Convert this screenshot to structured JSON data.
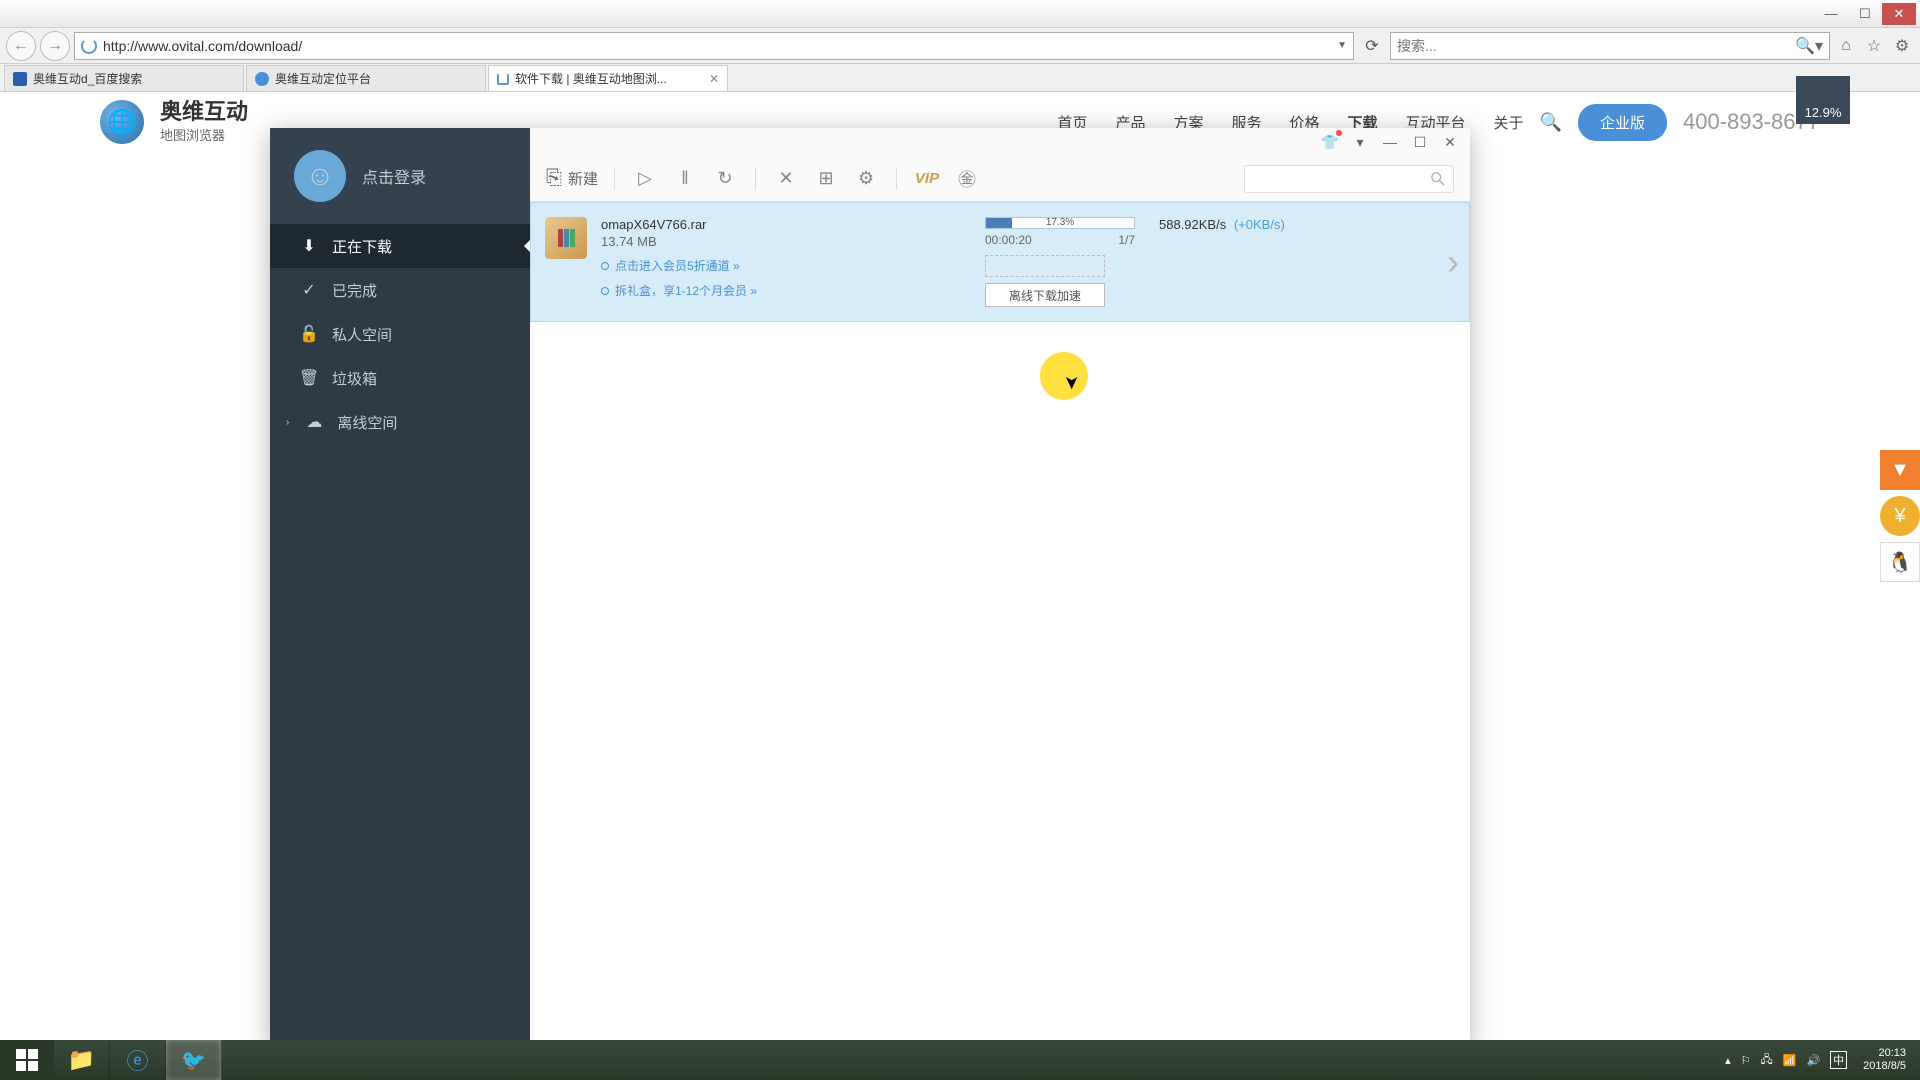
{
  "browser": {
    "url": "http://www.ovital.com/download/",
    "search_placeholder": "搜索...",
    "tabs": [
      {
        "label": "奥维互动d_百度搜索"
      },
      {
        "label": "奥维互动定位平台"
      },
      {
        "label": "软件下载 | 奥维互动地图浏..."
      }
    ]
  },
  "site": {
    "title": "奥维互动",
    "subtitle": "地图浏览器",
    "nav": [
      "首页",
      "产品",
      "方案",
      "服务",
      "价格",
      "下载",
      "互动平台",
      "关于"
    ],
    "enterprise_btn": "企业版",
    "phone": "400-893-8677"
  },
  "zoom_indicator": "12.9%",
  "dm": {
    "login_label": "点击登录",
    "menu": {
      "downloading": "正在下载",
      "completed": "已完成",
      "private": "私人空间",
      "trash": "垃圾箱",
      "offline": "离线空间"
    },
    "toolbar": {
      "new_label": "新建",
      "vip_label": "VIP"
    },
    "item": {
      "filename": "omapX64V766.rar",
      "filesize": "13.74 MB",
      "promo1": "点击进入会员5折通道 »",
      "promo2": "拆礼盒，享1-12个月会员 »",
      "progress_pct": "17.3%",
      "progress_fill_pct": 17.3,
      "elapsed": "00:00:20",
      "threads": "1/7",
      "speed": "588.92KB/s",
      "speed_plus": "(+0KB/s)",
      "offline_btn": "离线下载加速"
    }
  },
  "taskbar": {
    "time": "20:13",
    "date": "2018/8/5",
    "ime": "中"
  }
}
